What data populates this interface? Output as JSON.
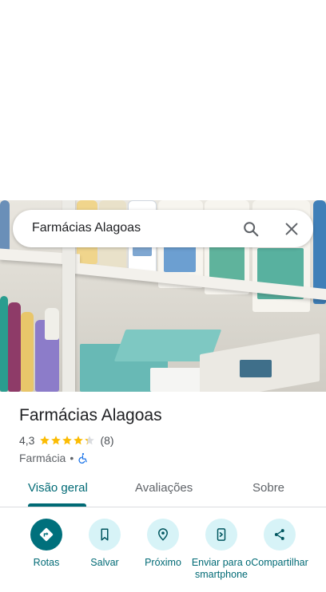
{
  "search": {
    "query": "Farmácias Alagoas"
  },
  "place": {
    "title": "Farmácias Alagoas",
    "rating": "4,3",
    "stars_value": 4.3,
    "review_count": "(8)",
    "category": "Farmácia",
    "separator": "•"
  },
  "tabs": [
    {
      "label": "Visão geral",
      "active": true
    },
    {
      "label": "Avaliações",
      "active": false
    },
    {
      "label": "Sobre",
      "active": false
    }
  ],
  "actions": [
    {
      "label": "Rotas",
      "icon": "directions-icon"
    },
    {
      "label": "Salvar",
      "icon": "bookmark-icon"
    },
    {
      "label": "Próximo",
      "icon": "nearby-icon"
    },
    {
      "label": "Enviar para o smartphone",
      "icon": "send-to-phone-icon"
    },
    {
      "label": "Compartilhar",
      "icon": "share-icon"
    }
  ],
  "colors": {
    "accent": "#006a75",
    "star": "#fbbc04",
    "chip_bg": "#d7f3f7",
    "primary_chip": "#00707c"
  }
}
